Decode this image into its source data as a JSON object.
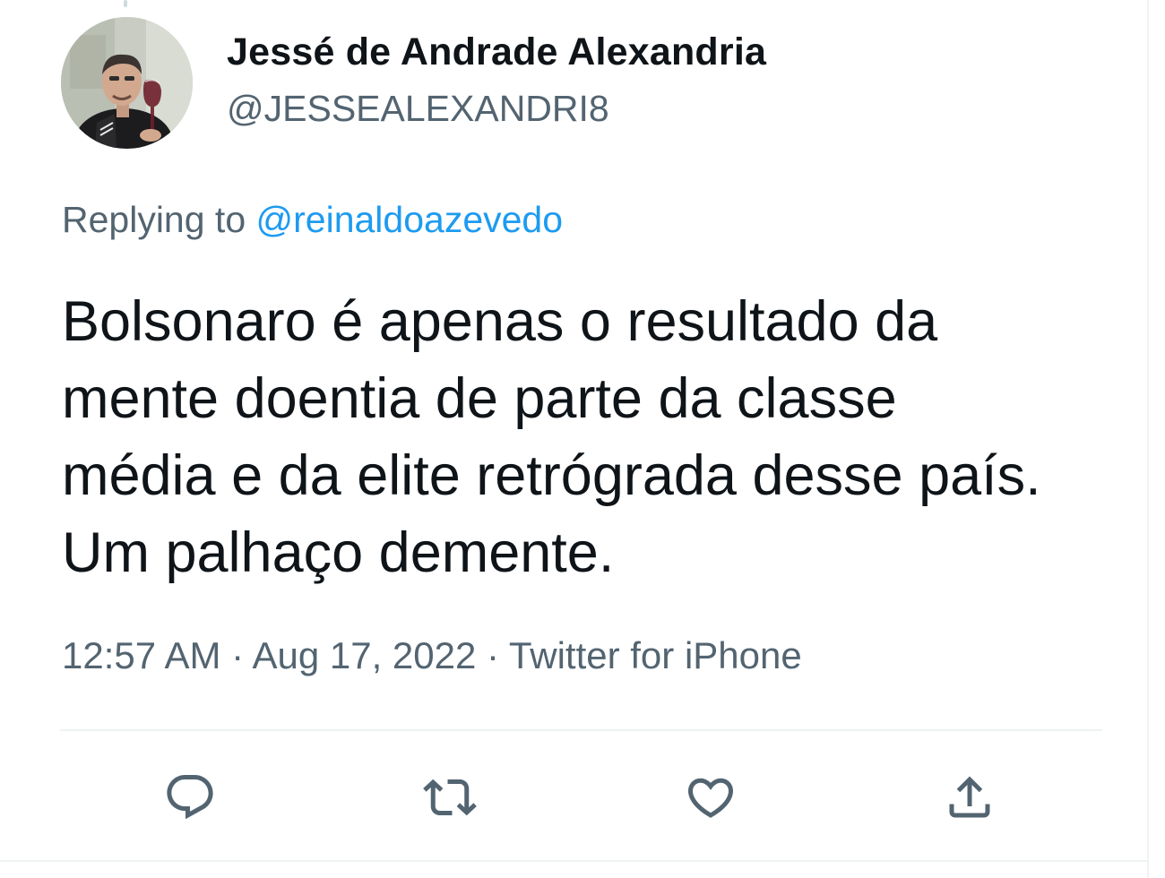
{
  "tweet": {
    "author": {
      "display_name": "Jessé de Andrade Alexandria",
      "handle": "@JESSEALEXANDRI8"
    },
    "reply": {
      "prefix": "Replying to ",
      "mention": "@reinaldoazevedo"
    },
    "text": "Bolsonaro é apenas o resultado da\nmente doentia de parte da classe\nmédia e da elite retrógrada desse país.\nUm palhaço demente.",
    "meta": "12:57 AM · Aug 17, 2022 · Twitter for iPhone"
  },
  "actions": {
    "reply_icon": "reply-icon",
    "retweet_icon": "retweet-icon",
    "like_icon": "heart-icon",
    "share_icon": "share-icon"
  },
  "colors": {
    "text_primary": "#0f1419",
    "text_secondary": "#536471",
    "link": "#1d9bf0",
    "divider": "#eff3f4"
  }
}
